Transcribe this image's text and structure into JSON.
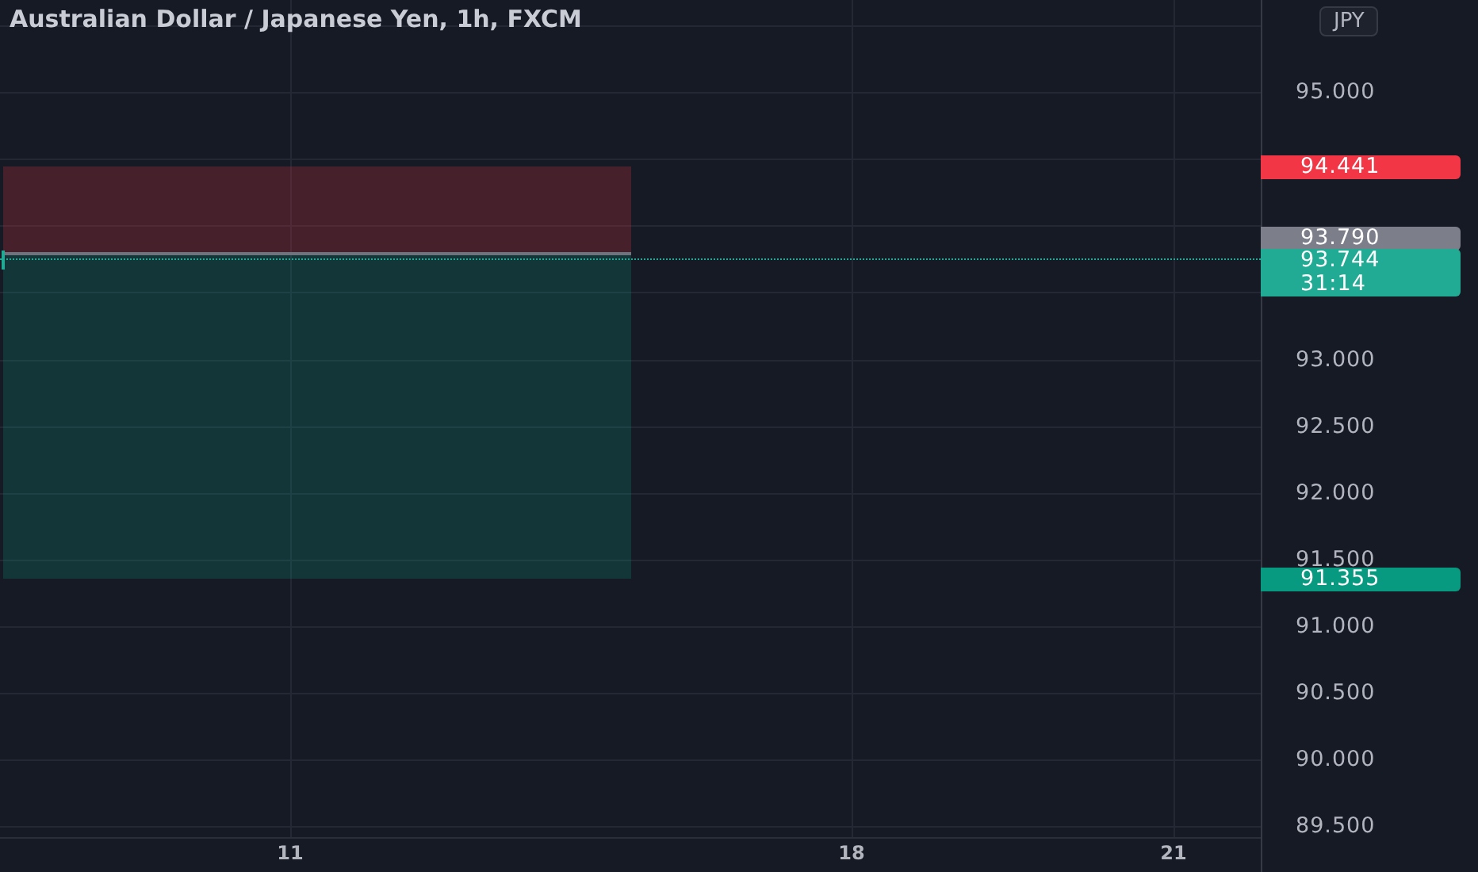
{
  "title": "Australian Dollar / Japanese Yen, 1h, FXCM",
  "currency": "JPY",
  "price_ticks": [
    "95.000",
    "93.000",
    "92.500",
    "92.000",
    "91.500",
    "91.000",
    "90.500",
    "90.000",
    "89.500"
  ],
  "price_badges": [
    {
      "kind": "stop",
      "label": "94.441"
    },
    {
      "kind": "entry",
      "label": "93.790"
    },
    {
      "kind": "last",
      "label": "93.744",
      "countdown": "31:14"
    },
    {
      "kind": "target",
      "label": "91.355"
    }
  ],
  "time_ticks": [
    "11",
    "18",
    "21"
  ]
}
